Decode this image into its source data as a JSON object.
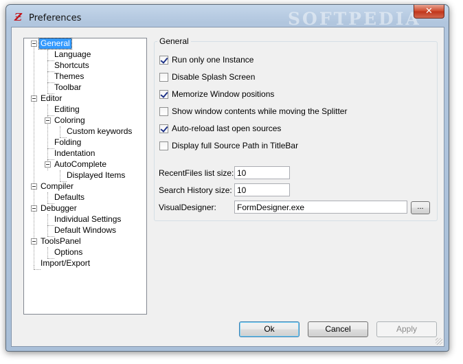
{
  "window": {
    "title": "Preferences",
    "watermark": "SOFTPEDIA",
    "close_symbol": "✕",
    "app_icon": "Ƶ"
  },
  "tree": {
    "nodes": [
      {
        "id": "general",
        "label": "General",
        "selected": true
      },
      {
        "id": "language",
        "label": "Language"
      },
      {
        "id": "shortcuts",
        "label": "Shortcuts"
      },
      {
        "id": "themes",
        "label": "Themes"
      },
      {
        "id": "toolbar",
        "label": "Toolbar"
      },
      {
        "id": "editor",
        "label": "Editor"
      },
      {
        "id": "editing",
        "label": "Editing"
      },
      {
        "id": "coloring",
        "label": "Coloring"
      },
      {
        "id": "custom-keywords",
        "label": "Custom keywords"
      },
      {
        "id": "folding",
        "label": "Folding"
      },
      {
        "id": "indentation",
        "label": "Indentation"
      },
      {
        "id": "autocomplete",
        "label": "AutoComplete"
      },
      {
        "id": "displayed-items",
        "label": "Displayed Items"
      },
      {
        "id": "compiler",
        "label": "Compiler"
      },
      {
        "id": "defaults",
        "label": "Defaults"
      },
      {
        "id": "debugger",
        "label": "Debugger"
      },
      {
        "id": "individual-settings",
        "label": "Individual Settings"
      },
      {
        "id": "default-windows",
        "label": "Default Windows"
      },
      {
        "id": "toolspanel",
        "label": "ToolsPanel"
      },
      {
        "id": "options",
        "label": "Options"
      },
      {
        "id": "import-export",
        "label": "Import/Export"
      }
    ]
  },
  "general": {
    "group_title": "General",
    "checkboxes": [
      {
        "label": "Run only one Instance",
        "checked": true
      },
      {
        "label": "Disable Splash Screen",
        "checked": false
      },
      {
        "label": "Memorize Window positions",
        "checked": true
      },
      {
        "label": "Show window contents while moving the Splitter",
        "checked": false
      },
      {
        "label": "Auto-reload last open sources",
        "checked": true
      },
      {
        "label": "Display full Source Path in TitleBar",
        "checked": false
      }
    ],
    "recent_files_label": "RecentFiles list size:",
    "recent_files_value": "10",
    "search_history_label": "Search History size:",
    "search_history_value": "10",
    "visual_designer_label": "VisualDesigner:",
    "visual_designer_value": "FormDesigner.exe",
    "browse_label": "..."
  },
  "buttons": {
    "ok": "Ok",
    "cancel": "Cancel",
    "apply": "Apply"
  }
}
